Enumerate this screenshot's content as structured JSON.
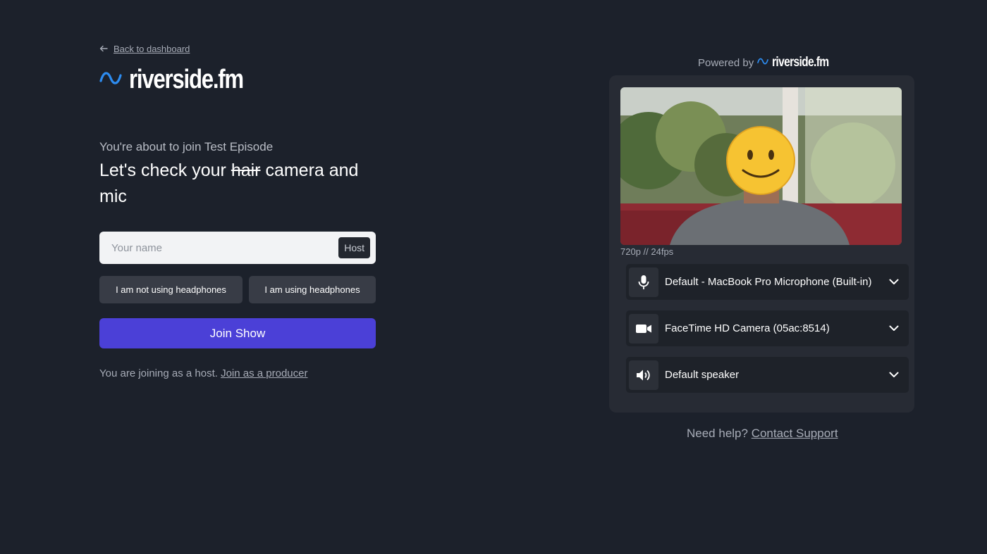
{
  "back_link": {
    "label": "Back to dashboard"
  },
  "brand": {
    "name": "riverside.fm",
    "accent": "#2d8cf0"
  },
  "intro": {
    "subtitle": "You're about to join Test Episode",
    "headline_before": "Let's check your ",
    "headline_struck": "hair",
    "headline_after": " camera and mic"
  },
  "name_input": {
    "placeholder": "Your name",
    "value": "",
    "role_badge": "Host"
  },
  "headphones": {
    "not_using_label": "I am not using headphones",
    "using_label": "I am using headphones"
  },
  "join_button": {
    "label": "Join Show",
    "color": "#4b40d7"
  },
  "host_note": {
    "text": "You are joining as a host. ",
    "link": "Join as a producer"
  },
  "powered_by": {
    "prefix": "Powered by",
    "brand": "riverside.fm"
  },
  "preview": {
    "resolution": "720p // 24fps"
  },
  "devices": [
    {
      "icon": "microphone-icon",
      "label": "Default - MacBook Pro Microphone (Built-in)"
    },
    {
      "icon": "camera-icon",
      "label": "FaceTime HD Camera (05ac:8514)"
    },
    {
      "icon": "speaker-icon",
      "label": "Default speaker"
    }
  ],
  "help": {
    "prefix": "Need help? ",
    "link": "Contact Support"
  }
}
